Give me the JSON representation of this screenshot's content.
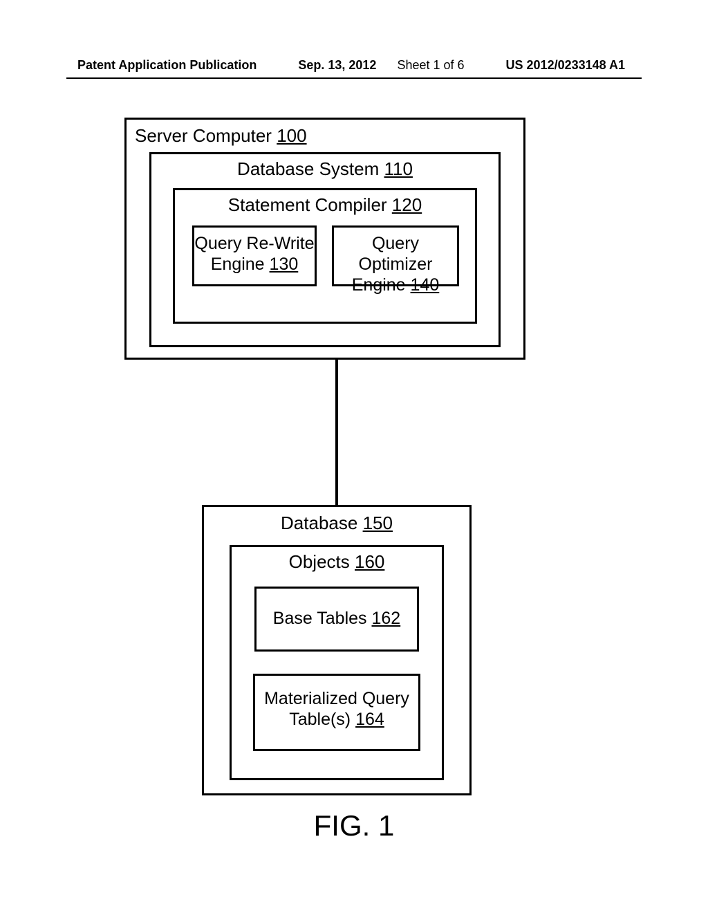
{
  "header": {
    "left": "Patent Application Publication",
    "date": "Sep. 13, 2012",
    "sheet": "Sheet 1 of 6",
    "pubnum": "US 2012/0233148 A1"
  },
  "server": {
    "label": "Server Computer",
    "num": "100"
  },
  "dbsystem": {
    "label": "Database System",
    "num": "110"
  },
  "compiler": {
    "label": "Statement Compiler",
    "num": "120"
  },
  "rewrite": {
    "line1": "Query Re-Write",
    "line2": "Engine",
    "num": "130"
  },
  "optimizer": {
    "line1": "Query Optimizer",
    "line2": "Engine",
    "num": "140"
  },
  "database": {
    "label": "Database",
    "num": "150"
  },
  "objects": {
    "label": "Objects",
    "num": "160"
  },
  "basetables": {
    "label": "Base Tables",
    "num": "162"
  },
  "mqt": {
    "line1": "Materialized Query",
    "line2": "Table(s)",
    "num": "164"
  },
  "figure": {
    "label": "FIG. 1"
  }
}
